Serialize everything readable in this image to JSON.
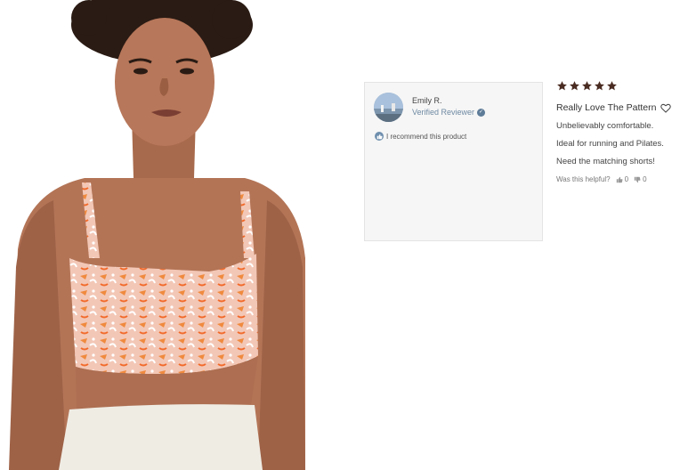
{
  "reviewer": {
    "name": "Emily R.",
    "badge": "Verified Reviewer",
    "recommend_text": "I recommend this product"
  },
  "review": {
    "rating": 5,
    "rating_max": 5,
    "title": "Really Love The Pattern",
    "lines": [
      "Unbelievably comfortable.",
      "Ideal for running and Pilates.",
      "Need the matching shorts!"
    ],
    "helpful_prompt": "Was this helpful?",
    "helpful_up_count": "0",
    "helpful_down_count": "0"
  },
  "icons": {
    "star": "star-icon",
    "heart": "heart-icon",
    "verified": "check-icon",
    "thumbs_up": "thumbs-up-icon",
    "thumbs_down": "thumbs-down-icon"
  },
  "colors": {
    "star": "#4a2c22",
    "verified": "#5e7c98",
    "card_bg": "#f6f6f6",
    "bra_pattern": "#f08a3e"
  }
}
